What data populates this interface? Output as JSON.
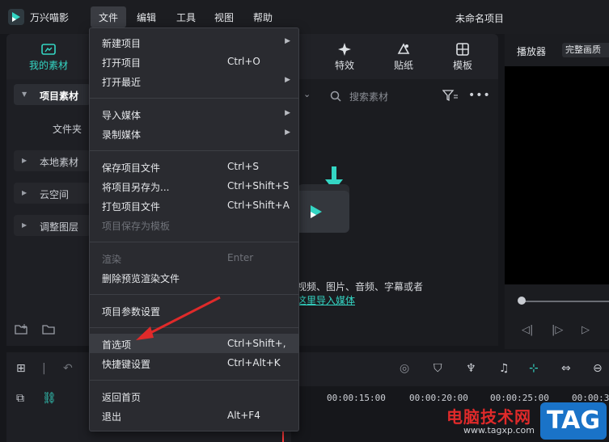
{
  "titlebar": {
    "app_name": "万兴喵影",
    "menus": [
      "文件",
      "编辑",
      "工具",
      "视图",
      "帮助"
    ],
    "project_title": "未命名项目"
  },
  "tabs": {
    "my_material": "我的素材",
    "effects": "特效",
    "stickers": "贴纸",
    "templates": "模板"
  },
  "sidebar": {
    "project_material": "项目素材",
    "folder": "文件夹",
    "local_material": "本地素材",
    "cloud_space": "云空间",
    "adjust_layer": "调整图层"
  },
  "search": {
    "placeholder": "搜索素材"
  },
  "import": {
    "hint": "视频、图片、音频、字幕或者",
    "link": "这里导入媒体"
  },
  "player": {
    "tab": "播放器",
    "mode": "完整画质"
  },
  "timeline": {
    "timecodes": [
      "00:00:15:00",
      "00:00:20:00",
      "00:00:25:00",
      "00:00:30"
    ]
  },
  "file_menu": {
    "items": [
      {
        "label": "新建项目",
        "shortcut": "",
        "submenu": true,
        "disabled": false
      },
      {
        "label": "打开项目",
        "shortcut": "Ctrl+O",
        "submenu": false,
        "disabled": false
      },
      {
        "label": "打开最近",
        "shortcut": "",
        "submenu": true,
        "disabled": false
      },
      {
        "label": "导入媒体",
        "shortcut": "",
        "submenu": true,
        "disabled": false
      },
      {
        "label": "录制媒体",
        "shortcut": "",
        "submenu": true,
        "disabled": false
      },
      {
        "label": "保存项目文件",
        "shortcut": "Ctrl+S",
        "submenu": false,
        "disabled": false
      },
      {
        "label": "将项目另存为...",
        "shortcut": "Ctrl+Shift+S",
        "submenu": false,
        "disabled": false
      },
      {
        "label": "打包项目文件",
        "shortcut": "Ctrl+Shift+A",
        "submenu": false,
        "disabled": false
      },
      {
        "label": "项目保存为模板",
        "shortcut": "",
        "submenu": false,
        "disabled": true
      },
      {
        "label": "渲染",
        "shortcut": "Enter",
        "submenu": false,
        "disabled": true
      },
      {
        "label": "删除预览渲染文件",
        "shortcut": "",
        "submenu": false,
        "disabled": false
      },
      {
        "label": "项目参数设置",
        "shortcut": "",
        "submenu": false,
        "disabled": false
      },
      {
        "label": "首选项",
        "shortcut": "Ctrl+Shift+,",
        "submenu": false,
        "disabled": false,
        "highlighted": true
      },
      {
        "label": "快捷键设置",
        "shortcut": "Ctrl+Alt+K",
        "submenu": false,
        "disabled": false
      },
      {
        "label": "返回首页",
        "shortcut": "",
        "submenu": false,
        "disabled": false
      },
      {
        "label": "退出",
        "shortcut": "Alt+F4",
        "submenu": false,
        "disabled": false
      }
    ]
  },
  "watermark": {
    "site_name": "电脑技术网",
    "url": "www.tagxp.com",
    "badge": "TAG"
  },
  "colors": {
    "accent": "#34d6c4",
    "annotation_arrow": "#e02a2a",
    "watermark_badge": "#1a73c8"
  }
}
